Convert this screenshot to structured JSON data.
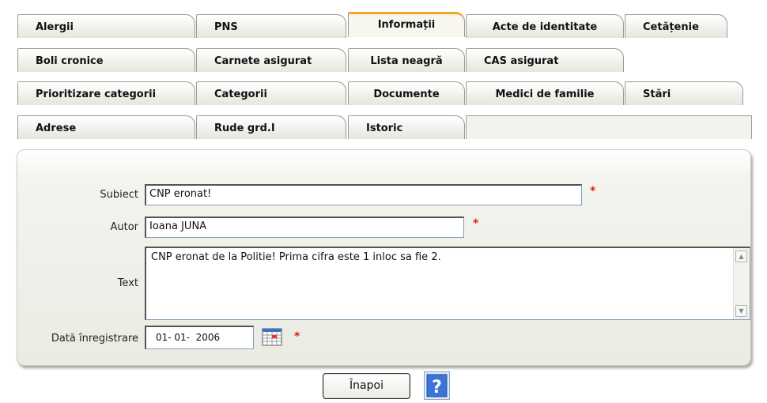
{
  "tabs": {
    "row1": [
      "Alergii",
      "PNS",
      "Informații",
      "Acte de identitate",
      "Cetățenie"
    ],
    "row2": [
      "Boli cronice",
      "Carnete asigurat",
      "Lista neagră",
      "CAS asigurat"
    ],
    "row3": [
      "Prioritizare categorii",
      "Categorii",
      "Documente",
      "Medici de familie",
      "Stări"
    ],
    "row4": [
      "Adrese",
      "Rude grd.I",
      "Istoric"
    ],
    "active": "Informații"
  },
  "form": {
    "subiect_label": "Subiect",
    "subiect_value": "CNP eronat!",
    "autor_label": "Autor",
    "autor_value": "Ioana JUNA",
    "text_label": "Text",
    "text_value": "CNP eronat de la Politie! Prima cifra este 1 inloc sa fie 2.",
    "date_label": "Dată înregistrare",
    "date_value": "01- 01-  2006",
    "required_mark": "*"
  },
  "buttons": {
    "back_label": "Înapoi",
    "help_label": "?"
  },
  "colors": {
    "active_tab_accent": "#f5a623",
    "required": "#e21d1d",
    "help_blue": "#3b74d6"
  }
}
